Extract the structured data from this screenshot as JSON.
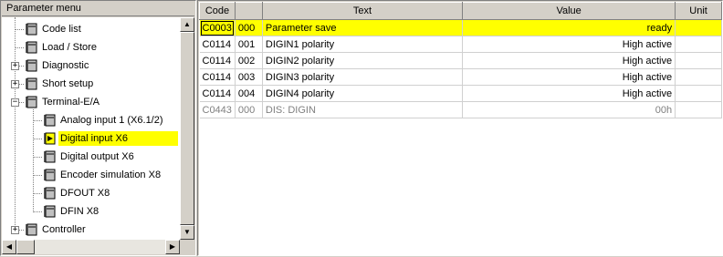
{
  "tree": {
    "header": "Parameter menu",
    "items": [
      {
        "label": "Code list",
        "expander": "",
        "icon": "parameter-book-icon"
      },
      {
        "label": "Load / Store",
        "expander": "",
        "icon": "parameter-book-icon"
      },
      {
        "label": "Diagnostic",
        "expander": "+",
        "icon": "parameter-book-icon"
      },
      {
        "label": "Short setup",
        "expander": "+",
        "icon": "parameter-book-icon"
      },
      {
        "label": "Terminal-E/A",
        "expander": "−",
        "icon": "parameter-book-icon"
      },
      {
        "label": "Analog input 1 (X6.1/2)",
        "expander": "",
        "icon": "parameter-book-icon"
      },
      {
        "label": "Digital input X6",
        "expander": "",
        "icon": "parameter-book-selected-icon"
      },
      {
        "label": "Digital output X6",
        "expander": "",
        "icon": "parameter-book-icon"
      },
      {
        "label": "Encoder simulation X8",
        "expander": "",
        "icon": "parameter-book-icon"
      },
      {
        "label": "DFOUT X8",
        "expander": "",
        "icon": "parameter-book-icon"
      },
      {
        "label": "DFIN X8",
        "expander": "",
        "icon": "parameter-book-icon"
      },
      {
        "label": "Controller",
        "expander": "+",
        "icon": "parameter-book-icon"
      }
    ],
    "selected_label": "Digital input X6"
  },
  "table": {
    "columns": [
      "Code",
      "",
      "Text",
      "Value",
      "Unit"
    ],
    "rows": [
      {
        "code": "C0003",
        "sub": "000",
        "text": "Parameter save",
        "value": "ready",
        "unit": ""
      },
      {
        "code": "C0114",
        "sub": "001",
        "text": "DIGIN1 polarity",
        "value": "High active",
        "unit": ""
      },
      {
        "code": "C0114",
        "sub": "002",
        "text": "DIGIN2 polarity",
        "value": "High active",
        "unit": ""
      },
      {
        "code": "C0114",
        "sub": "003",
        "text": "DIGIN3 polarity",
        "value": "High active",
        "unit": ""
      },
      {
        "code": "C0114",
        "sub": "004",
        "text": "DIGIN4 polarity",
        "value": "High active",
        "unit": ""
      },
      {
        "code": "C0443",
        "sub": "000",
        "text": "DIS: DIGIN",
        "value": "00h",
        "unit": ""
      }
    ]
  },
  "colors": {
    "highlight": "#ffff00",
    "dimmed_text": "#808080",
    "panel": "#d4d0c8"
  }
}
